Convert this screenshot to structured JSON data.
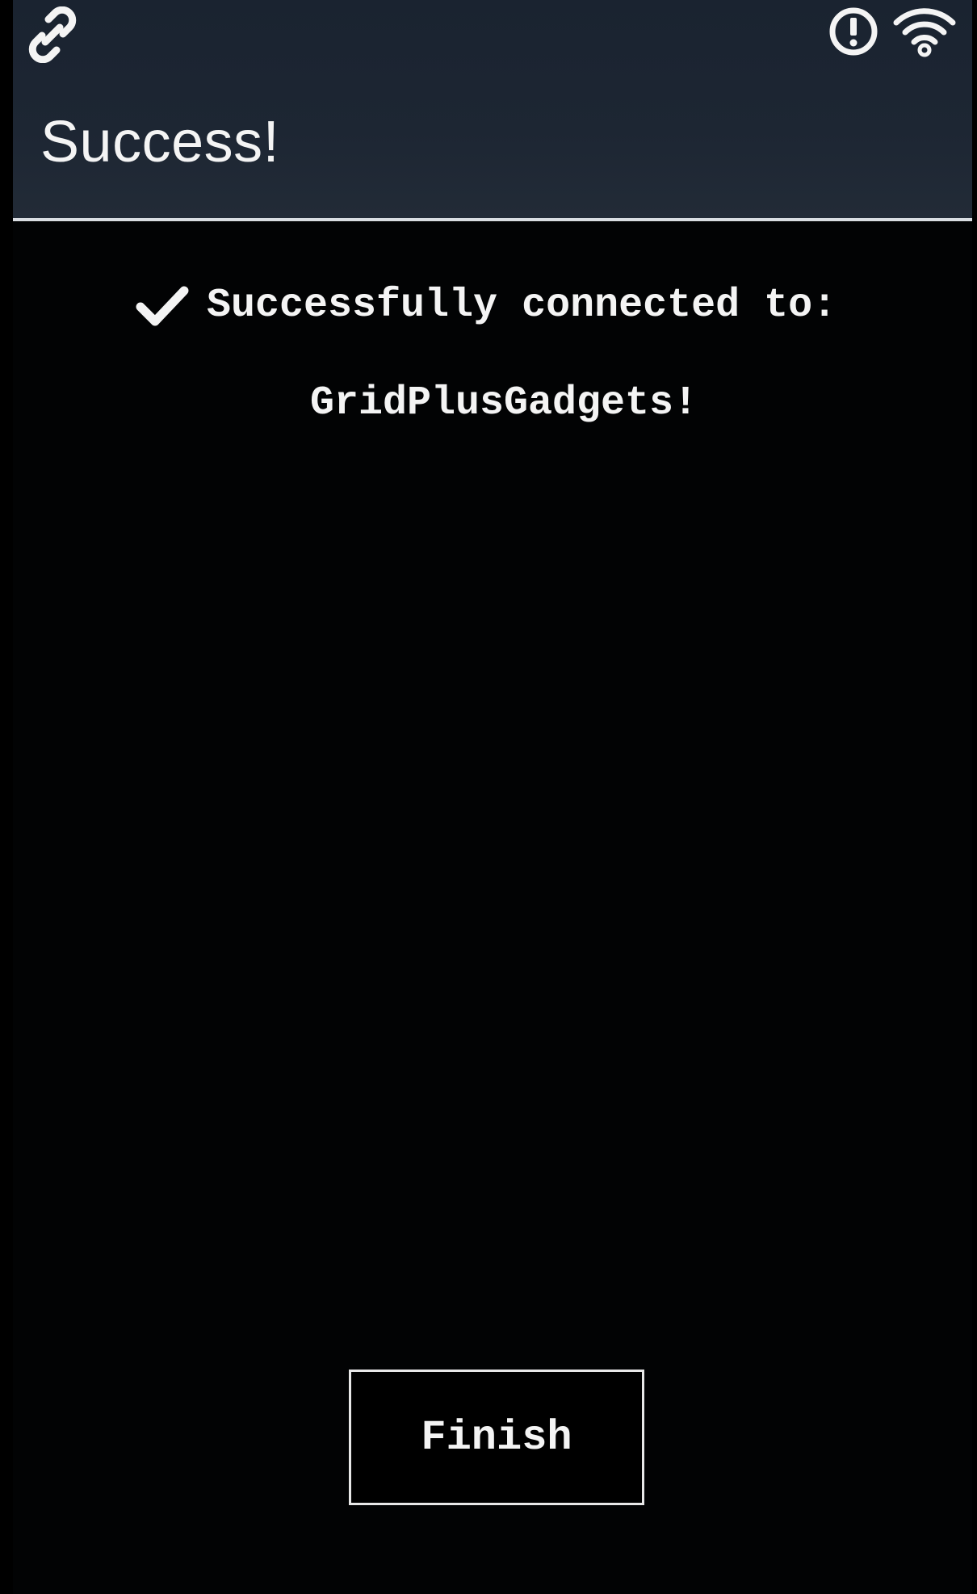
{
  "status_bar": {
    "left_icon": "link-icon",
    "right_icons": [
      "alert-circle-icon",
      "wifi-icon"
    ]
  },
  "header": {
    "title": "Success!"
  },
  "message": {
    "icon": "check-icon",
    "text": "Successfully connected to:",
    "network_name": "GridPlusGadgets!"
  },
  "actions": {
    "finish_label": "Finish"
  },
  "colors": {
    "background": "#000000",
    "header_background": "#1d2633",
    "text": "#f4f4f4",
    "divider": "#d9dde2"
  }
}
